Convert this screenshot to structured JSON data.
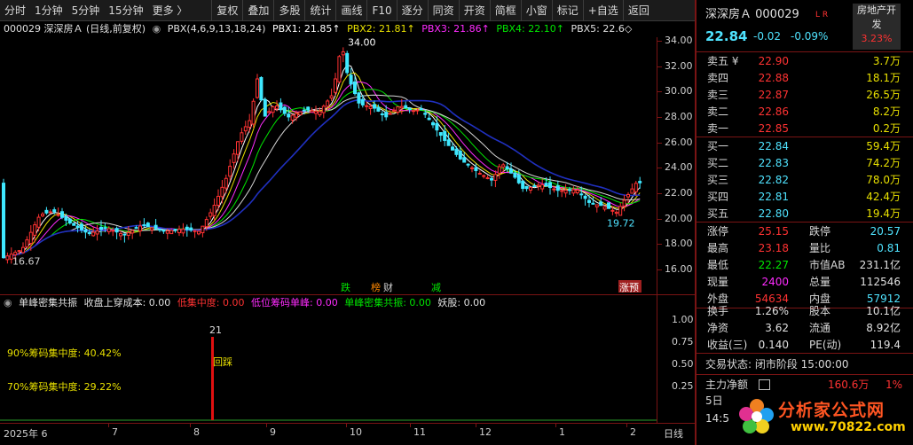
{
  "toolbar": [
    "分时",
    "1分钟",
    "5分钟",
    "15分钟",
    "更多 〉",
    "复权",
    "叠加",
    "多股",
    "统计",
    "画线",
    "F10",
    "逐分",
    "同资",
    "开资",
    "简框",
    "小窗",
    "标记",
    "+自选",
    "返回"
  ],
  "kline_header": {
    "title": "000029  深深房Ａ (日线,前复权)",
    "indicator": "PBX(4,6,9,13,18,24)",
    "pbx1": "PBX1: 21.85↑",
    "pbx2": "PBX2: 21.81↑",
    "pbx3": "PBX3: 21.86↑",
    "pbx4": "PBX4: 22.10↑",
    "pbx5": "PBX5: 22.6◇"
  },
  "price_axis": [
    "34.00",
    "32.00",
    "30.00",
    "28.00",
    "26.00",
    "24.00",
    "22.00",
    "20.00",
    "18.00",
    "16.00"
  ],
  "annotations": {
    "high": "34.00",
    "low": "19.72",
    "start": "16.67"
  },
  "markers": [
    {
      "text": "跌",
      "color": "#00e600"
    },
    {
      "text": "榜",
      "color": "#ff8800"
    },
    {
      "text": "财",
      "color": "#d0d0d0"
    },
    {
      "text": "减",
      "color": "#00e600"
    },
    {
      "text": "涨预",
      "color": "#ffffff"
    }
  ],
  "ind_header": {
    "name": "单峰密集共振",
    "i1": "收盘上穿成本: 0.00",
    "i2": "低集中度: 0.00",
    "i3": "低位筹码单峰: 0.00",
    "i4": "单峰密集共振: 0.00",
    "i5": "妖股: 0.00"
  },
  "ind_axis": [
    "1.00",
    "0.75",
    "0.50",
    "0.25"
  ],
  "ind_labels": {
    "c90": "90%筹码集中度:  40.42%",
    "c70": "70%筹码集中度:  29.22%",
    "bar_value": "21",
    "bar_label": "回踩"
  },
  "date_axis": [
    "2025年 6",
    "7",
    "8",
    "9",
    "10",
    "11",
    "12",
    "1",
    "2",
    "日线"
  ],
  "panel": {
    "title": "深深房Ａ  000029",
    "tag": "L R",
    "sector_line1": "房地产开",
    "sector_line2": "发",
    "sector_pct": "3.23%",
    "price": "22.84",
    "change": "-0.02",
    "pct": "-0.09%",
    "sells": [
      {
        "label": "卖五 ¥",
        "price": "22.90",
        "vol": "3.7万"
      },
      {
        "label": "卖四",
        "price": "22.88",
        "vol": "18.1万"
      },
      {
        "label": "卖三",
        "price": "22.87",
        "vol": "26.5万"
      },
      {
        "label": "卖二",
        "price": "22.86",
        "vol": "8.2万"
      },
      {
        "label": "卖一",
        "price": "22.85",
        "vol": "0.2万"
      }
    ],
    "buys": [
      {
        "label": "买一",
        "price": "22.84",
        "vol": "59.4万"
      },
      {
        "label": "买二",
        "price": "22.83",
        "vol": "74.2万"
      },
      {
        "label": "买三",
        "price": "22.82",
        "vol": "78.0万"
      },
      {
        "label": "买四",
        "price": "22.81",
        "vol": "42.4万"
      },
      {
        "label": "买五",
        "price": "22.80",
        "vol": "19.4万"
      }
    ],
    "stats1": [
      {
        "l1": "涨停",
        "v1": "25.15",
        "c1": "red",
        "l2": "跌停",
        "v2": "20.57",
        "c2": "cyan"
      },
      {
        "l1": "最高",
        "v1": "23.18",
        "c1": "red",
        "l2": "量比",
        "v2": "0.81",
        "c2": "cyan"
      },
      {
        "l1": "最低",
        "v1": "22.27",
        "c1": "green",
        "l2": "市值AB",
        "v2": "231.1亿",
        "c2": "white"
      },
      {
        "l1": "现量",
        "v1": "2400",
        "c1": "magenta",
        "l2": "总量",
        "v2": "112546",
        "c2": "white"
      },
      {
        "l1": "外盘",
        "v1": "54634",
        "c1": "red",
        "l2": "内盘",
        "v2": "57912",
        "c2": "cyan"
      }
    ],
    "stats2": [
      {
        "l1": "换手",
        "v1": "1.26%",
        "l2": "股本",
        "v2": "10.1亿"
      },
      {
        "l1": "净资",
        "v1": "3.62",
        "l2": "流通",
        "v2": "8.92亿"
      },
      {
        "l1": "收益(三)",
        "v1": "0.140",
        "l2": "PE(动)",
        "v2": "119.4"
      }
    ],
    "status": "交易状态: 闭市阶段 15:00:00",
    "flow_label": "主力净额",
    "flow_value": "160.6万",
    "flow_pct": "1%",
    "day_label": "5日",
    "time_label": "14:5",
    "brand1": "分析家公式网",
    "brand2": "www.70822.com"
  },
  "colors": {
    "up": "#ff3232",
    "down": "#3fe8ff",
    "frame": "#7a1414"
  }
}
